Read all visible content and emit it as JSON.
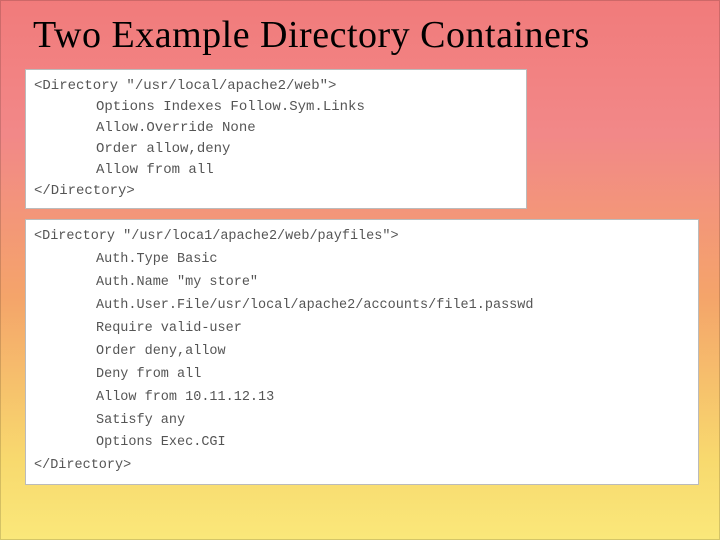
{
  "title": "Two Example Directory Containers",
  "block1": {
    "open": "<Directory \"/usr/local/apache2/web\">",
    "l1": "Options Indexes Follow.Sym.Links",
    "l2": "Allow.Override None",
    "l3": "Order allow,deny",
    "l4": "Allow from all",
    "close": "</Directory>"
  },
  "block2": {
    "open": "<Directory \"/usr/loca1/apache2/web/payfiles\">",
    "l1": "Auth.Type Basic",
    "l2": "Auth.Name \"my store\"",
    "l3": "Auth.User.File/usr/local/apache2/accounts/file1.passwd",
    "l4": "Require valid-user",
    "l5": "Order deny,allow",
    "l6": "Deny from all",
    "l7": "Allow from 10.11.12.13",
    "l8": "Satisfy any",
    "l9": "Options Exec.CGI",
    "close": "</Directory>"
  }
}
